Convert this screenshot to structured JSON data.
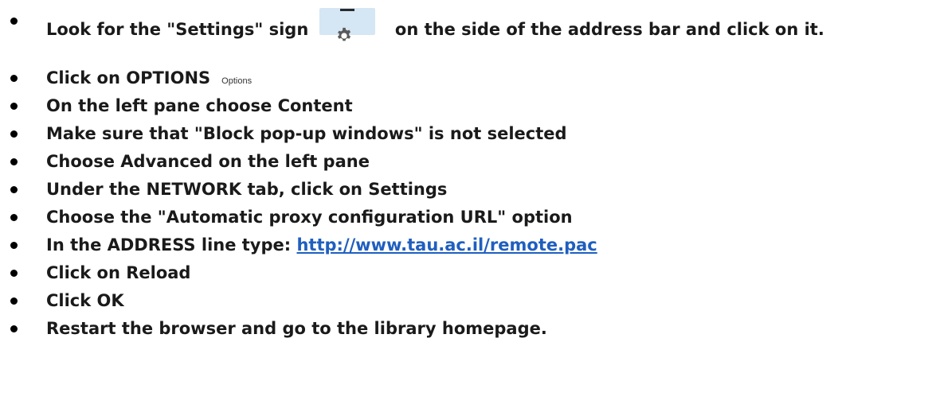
{
  "steps": [
    {
      "before": "Look for the \"Settings\" sign",
      "icon": "hamburger-menu-icon",
      "after": "on the side of the address bar and click on it."
    },
    {
      "text": "Click on OPTIONS",
      "icon": "gear-icon",
      "caption": "Options"
    },
    {
      "text": "On the left pane choose Content"
    },
    {
      "before": "Make sure that \"Block pop-up windows\" is",
      "emphasis": "not",
      "after": "selected"
    },
    {
      "text": "Choose Advanced on the left pane"
    },
    {
      "text": "Under the NETWORK tab, click on Settings"
    },
    {
      "text": "Choose the \"Automatic proxy configuration URL\" option"
    },
    {
      "before": "In the ADDRESS line type:",
      "link": "http://www.tau.ac.il/remote.pac"
    },
    {
      "text": "Click on Reload"
    },
    {
      "text": "Click OK"
    },
    {
      "text": "Restart the browser and go to the library homepage."
    }
  ],
  "colors": {
    "text": "#1a1a1a",
    "link": "#1f5fbf",
    "settings_button_bg": "#d5e6f4",
    "gear": "#5a5a5a"
  }
}
